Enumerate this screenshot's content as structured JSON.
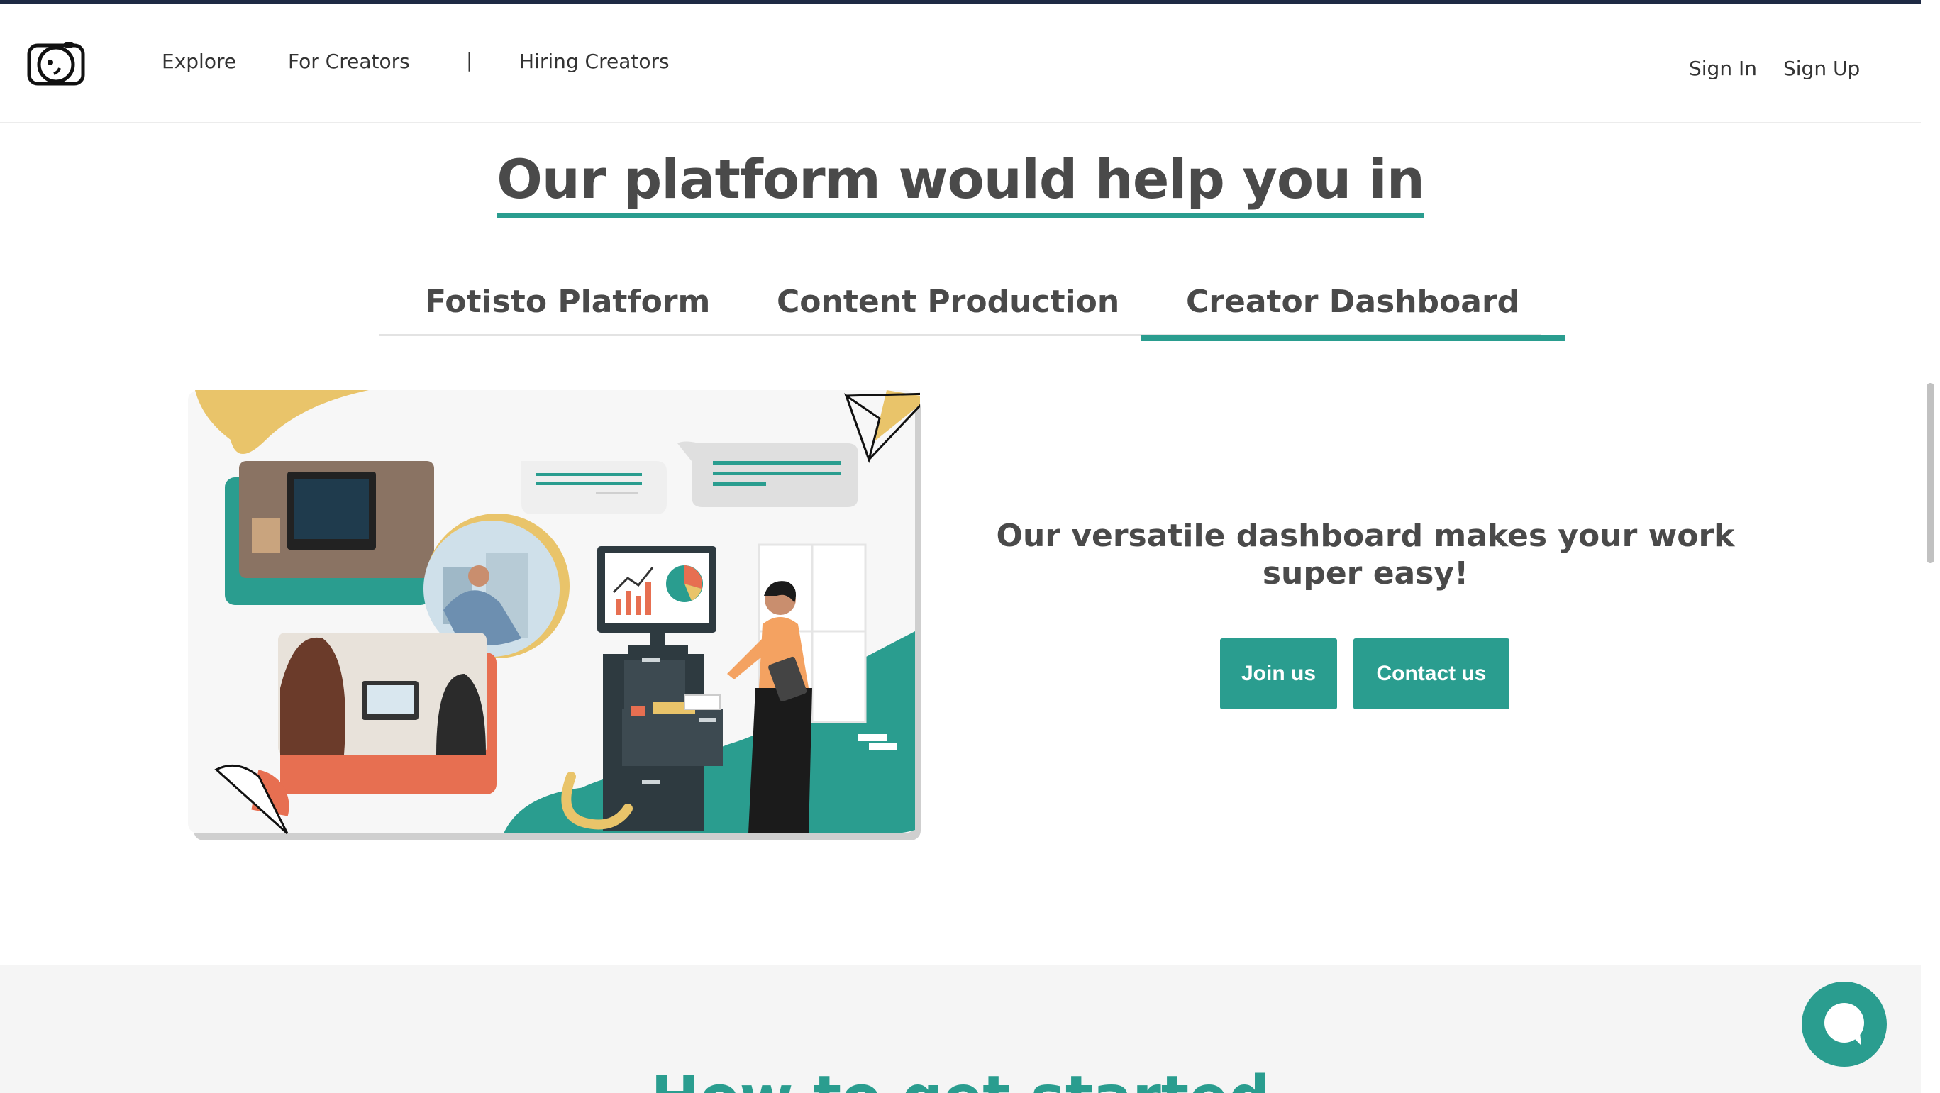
{
  "header": {
    "nav": {
      "explore": "Explore",
      "for_creators": "For Creators",
      "separator": "|",
      "hiring_creators": "Hiring Creators"
    },
    "auth": {
      "sign_in": "Sign In",
      "sign_up": "Sign Up"
    }
  },
  "section": {
    "title": "Our platform would help you in",
    "tabs": [
      {
        "label": "Fotisto Platform",
        "active": false
      },
      {
        "label": "Content Production",
        "active": false
      },
      {
        "label": "Creator Dashboard",
        "active": true
      }
    ],
    "promo_text": "Our versatile dashboard makes your work super easy!",
    "join_button": "Join us",
    "contact_button": "Contact us"
  },
  "lower": {
    "title": "How to get started"
  },
  "icons": {
    "logo": "camera-logo-icon",
    "chat": "chat-bubble-icon"
  },
  "colors": {
    "accent": "#2a9d8f",
    "coral": "#e76f51",
    "yellow": "#e9c46a",
    "text": "#4a4a4a"
  }
}
